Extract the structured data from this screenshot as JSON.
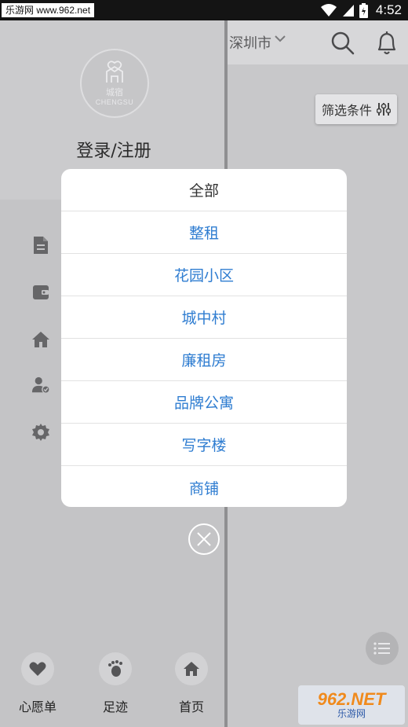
{
  "status_bar": {
    "watermark": "乐游网 www.962.net",
    "time": "4:52"
  },
  "topbar": {
    "city": "深圳市",
    "icons": [
      "chevron-down-icon",
      "search-icon",
      "bell-icon"
    ]
  },
  "filter_button": {
    "label": "筛选条件",
    "icon": "sliders-icon"
  },
  "drawer": {
    "avatar_brand": "CHENGSU",
    "avatar_mark": "城宿",
    "login_label": "登录/注册",
    "menu_icons": [
      "document-icon",
      "wallet-icon",
      "home-icon",
      "user-verified-icon",
      "settings-gear-icon"
    ],
    "bottom_nav": [
      {
        "label": "心愿单",
        "icon": "heart-icon"
      },
      {
        "label": "足迹",
        "icon": "footprint-icon"
      },
      {
        "label": "首页",
        "icon": "home-icon"
      }
    ]
  },
  "popup": {
    "title": "全部",
    "options": [
      "整租",
      "花园小区",
      "城中村",
      "廉租房",
      "品牌公寓",
      "写字楼",
      "商铺"
    ]
  },
  "corner_watermark": {
    "logo": "962.NET",
    "sub": "乐游网"
  },
  "colors": {
    "accent": "#2f7dd1",
    "status_bar": "#141414"
  }
}
